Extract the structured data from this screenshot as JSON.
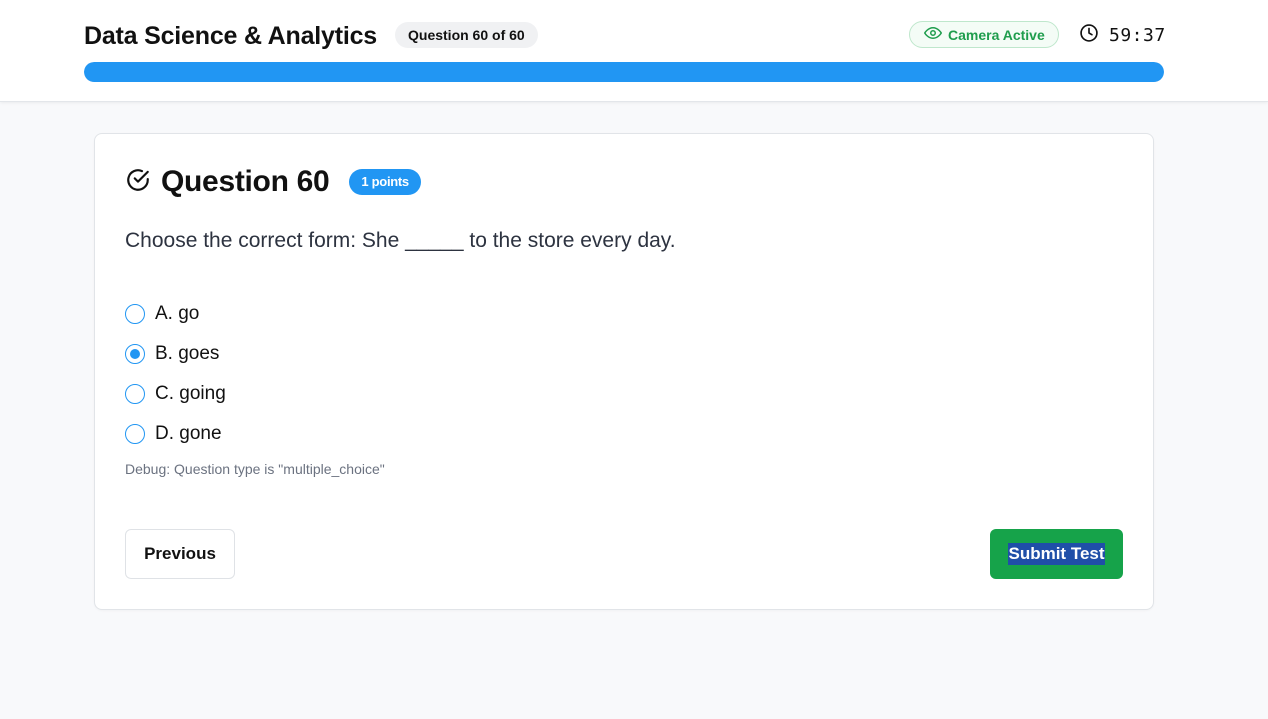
{
  "header": {
    "title": "Data Science & Analytics",
    "question_counter": "Question 60 of 60",
    "camera_status": "Camera Active",
    "timer": "59:37",
    "progress_fraction": 1.0
  },
  "question": {
    "title": "Question 60",
    "points": "1 points",
    "text": "Choose the correct form: She _____ to the store every day.",
    "options": [
      {
        "label": "A. go",
        "selected": false
      },
      {
        "label": "B. goes",
        "selected": true
      },
      {
        "label": "C. going",
        "selected": false
      },
      {
        "label": "D. gone",
        "selected": false
      }
    ],
    "debug": "Debug: Question type is \"multiple_choice\""
  },
  "nav": {
    "previous_label": "Previous",
    "submit_label": "Submit Test"
  },
  "colors": {
    "accent": "#2196f3",
    "success": "#16a34a"
  },
  "icons": {
    "camera": "eye-icon",
    "timer": "clock-icon",
    "question": "check-circle-icon"
  }
}
